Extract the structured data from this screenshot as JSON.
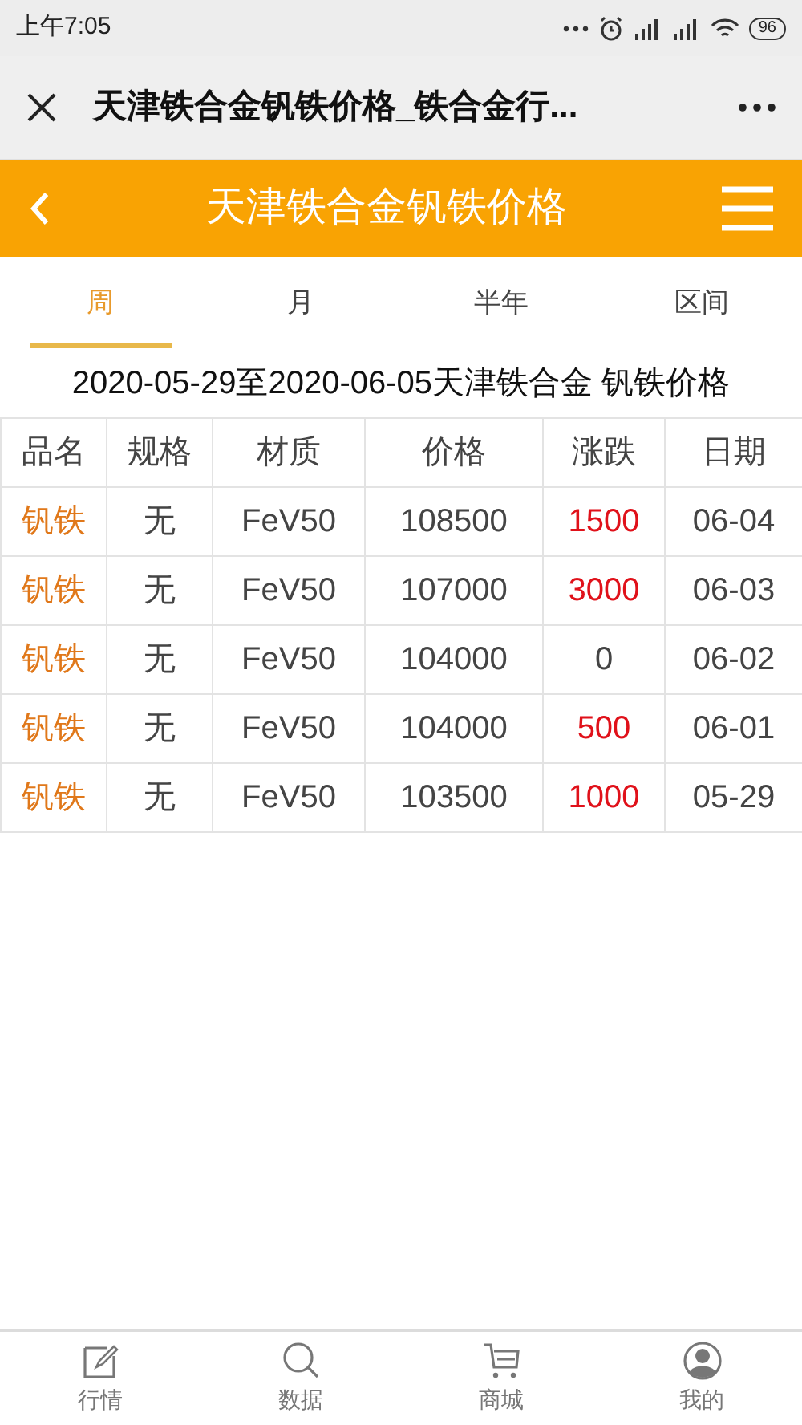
{
  "status_bar": {
    "time": "上午7:05",
    "battery": "96"
  },
  "browser": {
    "title": "天津铁合金钒铁价格_铁合金行..."
  },
  "header": {
    "title": "天津铁合金钒铁价格"
  },
  "tabs": [
    {
      "label": "周",
      "selected": true
    },
    {
      "label": "月",
      "selected": false
    },
    {
      "label": "半年",
      "selected": false
    },
    {
      "label": "区间",
      "selected": false
    }
  ],
  "subtitle": "2020-05-29至2020-06-05天津铁合金 钒铁价格",
  "table": {
    "columns": [
      "品名",
      "规格",
      "材质",
      "价格",
      "涨跌",
      "日期"
    ],
    "rows": [
      {
        "name": "钒铁",
        "spec": "无",
        "material": "FeV50",
        "price": "108500",
        "change": "1500",
        "kind": "rise",
        "date": "06-04"
      },
      {
        "name": "钒铁",
        "spec": "无",
        "material": "FeV50",
        "price": "107000",
        "change": "3000",
        "kind": "rise",
        "date": "06-03"
      },
      {
        "name": "钒铁",
        "spec": "无",
        "material": "FeV50",
        "price": "104000",
        "change": "0",
        "kind": "flat",
        "date": "06-02"
      },
      {
        "name": "钒铁",
        "spec": "无",
        "material": "FeV50",
        "price": "104000",
        "change": "500",
        "kind": "rise",
        "date": "06-01"
      },
      {
        "name": "钒铁",
        "spec": "无",
        "material": "FeV50",
        "price": "103500",
        "change": "1000",
        "kind": "rise",
        "date": "05-29"
      }
    ]
  },
  "bottom_nav": [
    {
      "label": "行情",
      "kind": "edit"
    },
    {
      "label": "数据",
      "kind": "search"
    },
    {
      "label": "商城",
      "kind": "cart"
    },
    {
      "label": "我的",
      "kind": "user"
    }
  ]
}
